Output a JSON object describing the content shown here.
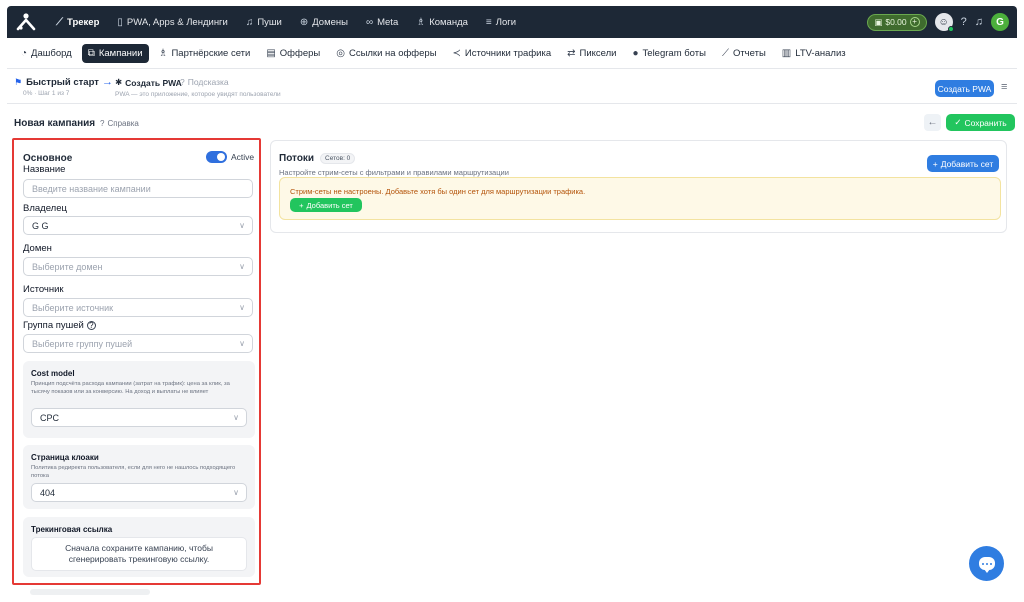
{
  "topbar": {
    "items": [
      {
        "icon": "chart-line-icon",
        "label": "Трекер",
        "active": true
      },
      {
        "icon": "mobile-icon",
        "label": "PWA, Apps & Лендинги"
      },
      {
        "icon": "bell-icon",
        "label": "Пуши"
      },
      {
        "icon": "globe-icon",
        "label": "Домены"
      },
      {
        "icon": "meta-icon",
        "label": "Meta"
      },
      {
        "icon": "team-icon",
        "label": "Команда"
      },
      {
        "icon": "list-icon",
        "label": "Логи"
      }
    ],
    "balance": "$0.00",
    "avatar_letter": "G"
  },
  "subnav": {
    "items": [
      {
        "icon": "dashboard-icon",
        "label": "Дашборд"
      },
      {
        "icon": "campaign-icon",
        "label": "Кампании",
        "active": true
      },
      {
        "icon": "partners-icon",
        "label": "Партнёрские сети"
      },
      {
        "icon": "offers-icon",
        "label": "Офферы"
      },
      {
        "icon": "link-icon",
        "label": "Ссылки на офферы"
      },
      {
        "icon": "share-icon",
        "label": "Источники трафика"
      },
      {
        "icon": "swap-icon",
        "label": "Пиксели"
      },
      {
        "icon": "telegram-icon",
        "label": "Telegram боты"
      },
      {
        "icon": "report-icon",
        "label": "Отчеты"
      },
      {
        "icon": "bar-chart-icon",
        "label": "LTV-анализ"
      }
    ]
  },
  "quickstart": {
    "title": "Быстрый старт",
    "progress": "0% · Шаг 1 из 7",
    "step": "Создать PWA",
    "hint": "Подсказка",
    "desc": "PWA — это приложение, которое увидят пользователи",
    "create_button": "Создать PWA"
  },
  "campaign": {
    "title": "Новая кампания",
    "help": "Справка",
    "save": "Сохранить"
  },
  "form": {
    "section_title": "Основное",
    "toggle_label": "Active",
    "name_label": "Название",
    "name_placeholder": "Введите название кампании",
    "owner_label": "Владелец",
    "owner_value": "G G",
    "domain_label": "Домен",
    "domain_placeholder": "Выберите домен",
    "source_label": "Источник",
    "source_placeholder": "Выберите источник",
    "push_group_label": "Группа пушей",
    "push_group_placeholder": "Выберите группу пушей",
    "cost_model": {
      "title": "Cost model",
      "desc": "Принцип подсчёта расхода кампании (затрат на трафик): цена за клик, за тысячу показов или за конверсию. На доход и выплаты не влияет",
      "value": "CPC"
    },
    "cloak_page": {
      "title": "Страница клоаки",
      "desc": "Политика редиректа пользователя, если для него не нашлось подходящего потока",
      "value": "404"
    },
    "tracking": {
      "title": "Трекинговая ссылка",
      "note": "Сначала сохраните кампанию, чтобы сгенерировать трекинговую ссылку."
    }
  },
  "flows": {
    "title": "Потоки",
    "badge": "Сетов: 0",
    "subtitle": "Настройте стрим-сеты с фильтрами и правилами маршрутизации",
    "add_set_top": "Добавить сет",
    "warning": "Стрим-сеты не настроены. Добавьте хотя бы один сет для маршрутизации трафика.",
    "add_set": "Добавить сет"
  }
}
